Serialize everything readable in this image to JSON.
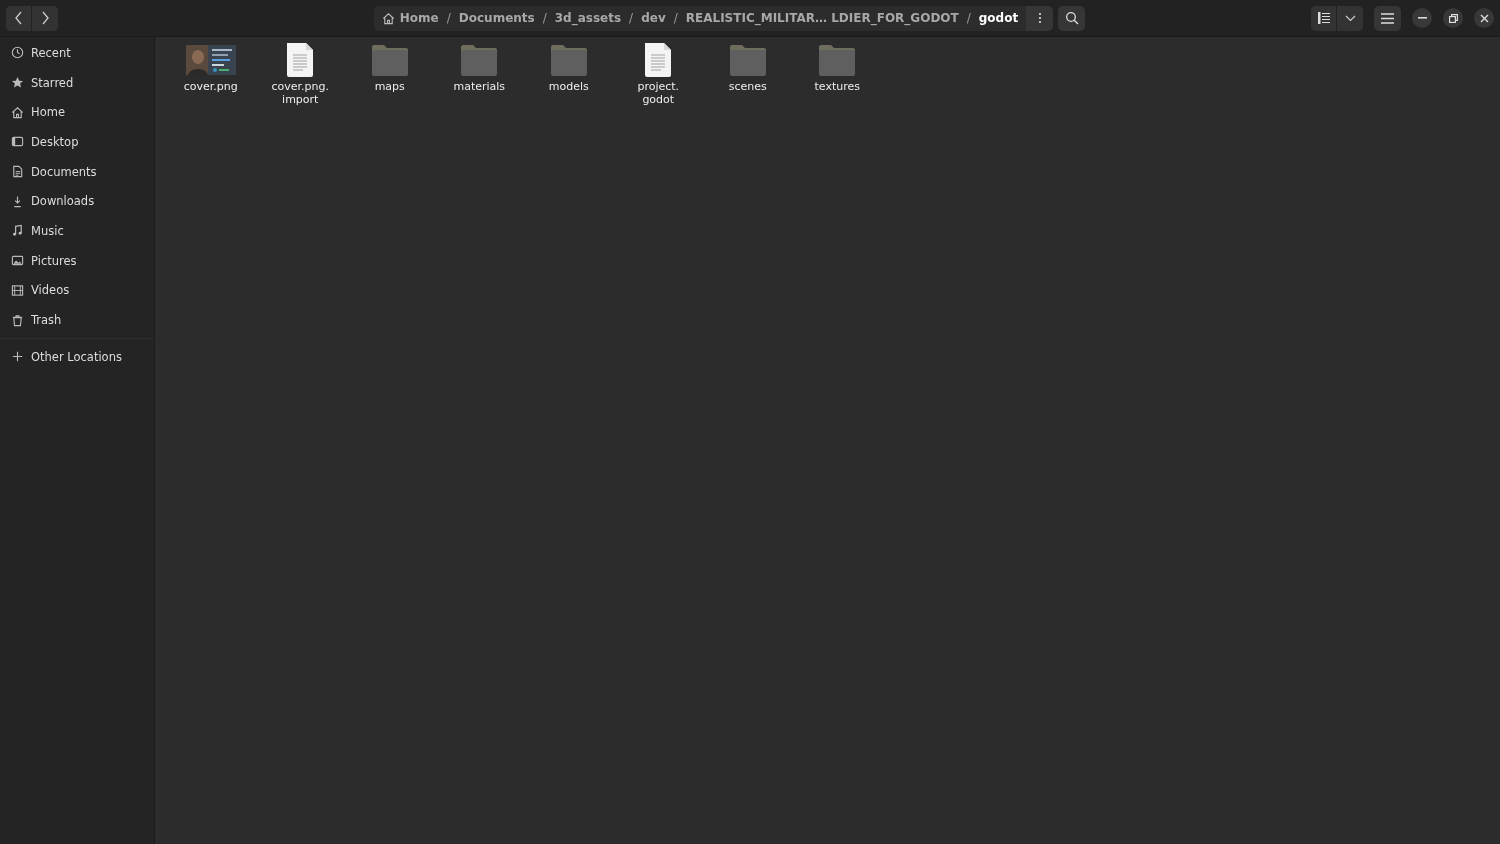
{
  "breadcrumb": [
    {
      "label": "Home",
      "selected": false
    },
    {
      "label": "Documents",
      "selected": false
    },
    {
      "label": "3d_assets",
      "selected": false
    },
    {
      "label": "dev",
      "selected": false
    },
    {
      "label": "REALISTIC_MILITAR… LDIER_FOR_GODOT",
      "selected": false
    },
    {
      "label": "godot",
      "selected": true
    }
  ],
  "separator": "/",
  "sidebar": {
    "items": [
      {
        "label": "Recent"
      },
      {
        "label": "Starred"
      },
      {
        "label": "Home"
      },
      {
        "label": "Desktop"
      },
      {
        "label": "Documents"
      },
      {
        "label": "Downloads"
      },
      {
        "label": "Music"
      },
      {
        "label": "Pictures"
      },
      {
        "label": "Videos"
      },
      {
        "label": "Trash"
      }
    ],
    "other": {
      "label": "Other Locations"
    }
  },
  "files": [
    {
      "name": "cover.png"
    },
    {
      "name": "cover.png.import",
      "kind": "document"
    },
    {
      "name": "maps",
      "kind": "folder"
    },
    {
      "name": "materials",
      "kind": "folder"
    },
    {
      "name": "models",
      "kind": "folder"
    },
    {
      "name": "project.godot",
      "kind": "document"
    },
    {
      "name": "scenes",
      "kind": "folder"
    },
    {
      "name": "textures",
      "kind": "folder"
    }
  ]
}
